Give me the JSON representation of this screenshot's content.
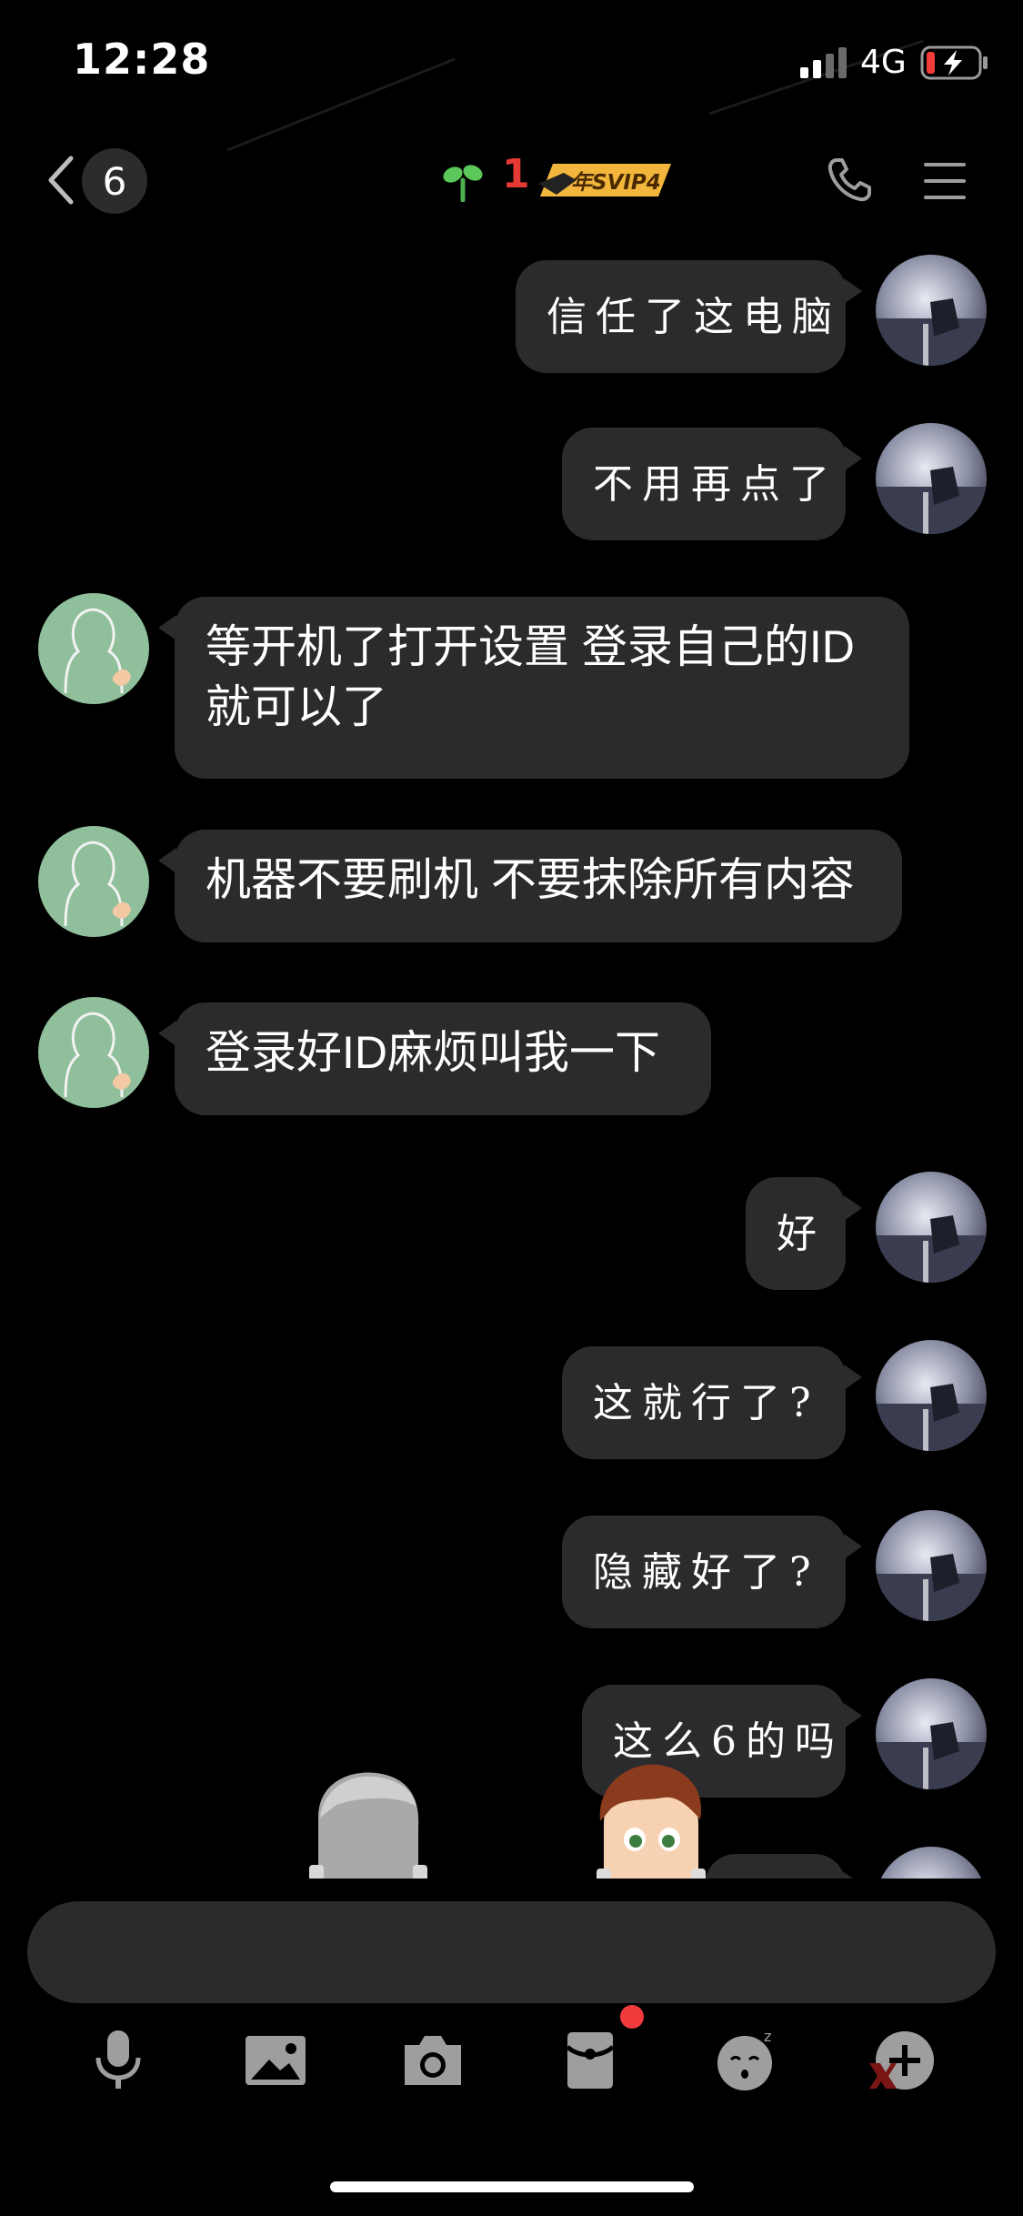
{
  "status_bar": {
    "time": "12:28",
    "network": "4G"
  },
  "nav": {
    "unread_count": "6",
    "member_count": "1",
    "vip_badge": "年SVIP4"
  },
  "messages": [
    {
      "direction": "outgoing",
      "text": "信任了这电脑"
    },
    {
      "direction": "outgoing",
      "text": "不用再点了"
    },
    {
      "direction": "incoming",
      "text": "等开机了打开设置 登录自己的ID就可以了"
    },
    {
      "direction": "incoming",
      "text": "机器不要刷机 不要抹除所有内容"
    },
    {
      "direction": "incoming",
      "text": "登录好ID麻烦叫我一下"
    },
    {
      "direction": "outgoing",
      "text": "好"
    },
    {
      "direction": "outgoing",
      "text": "这就行了?"
    },
    {
      "direction": "outgoing",
      "text": "隐藏好了?"
    },
    {
      "direction": "outgoing",
      "text": "这么6的吗"
    }
  ],
  "toolbar": {
    "icons": [
      "microphone-icon",
      "image-icon",
      "camera-icon",
      "red-packet-icon",
      "emoji-icon",
      "plus-icon"
    ]
  },
  "colors": {
    "background": "#000000",
    "bubble": "#2b2b2e",
    "accent_red": "#e53935",
    "badge_red": "#f23b3b"
  }
}
